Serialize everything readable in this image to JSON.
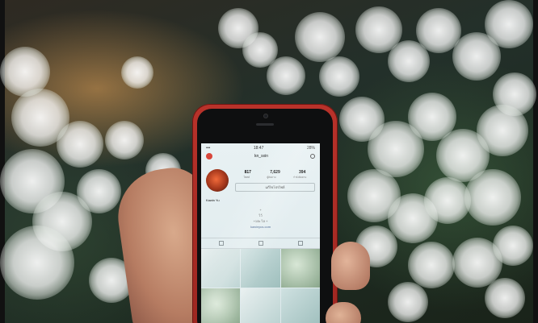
{
  "phone_screen": {
    "status_bar": {
      "time": "18:47",
      "battery": "28%"
    },
    "header": {
      "username": "kn_sxin"
    },
    "profile": {
      "display_name": "Kawin Yu",
      "counts": {
        "posts": "817",
        "followers": "7,629",
        "following": "394"
      },
      "count_labels": {
        "posts": "โพสต์",
        "followers": "ผู้ติดตาม",
        "following": "กำลังติดตาม"
      },
      "edit_button": "แก้ไขโปรไฟล์",
      "bio_lines": [
        "+",
        "ไว้",
        "+10k ไล +",
        "kawinyus.com"
      ]
    }
  },
  "colors": {
    "phone_case": "#b8322a",
    "screen_background": "#e8f1f3",
    "link": "#3d5b8a"
  },
  "icons": [
    "instagram-logo-icon",
    "gear-icon",
    "grid-tab-icon",
    "list-tab-icon",
    "tagged-tab-icon"
  ]
}
